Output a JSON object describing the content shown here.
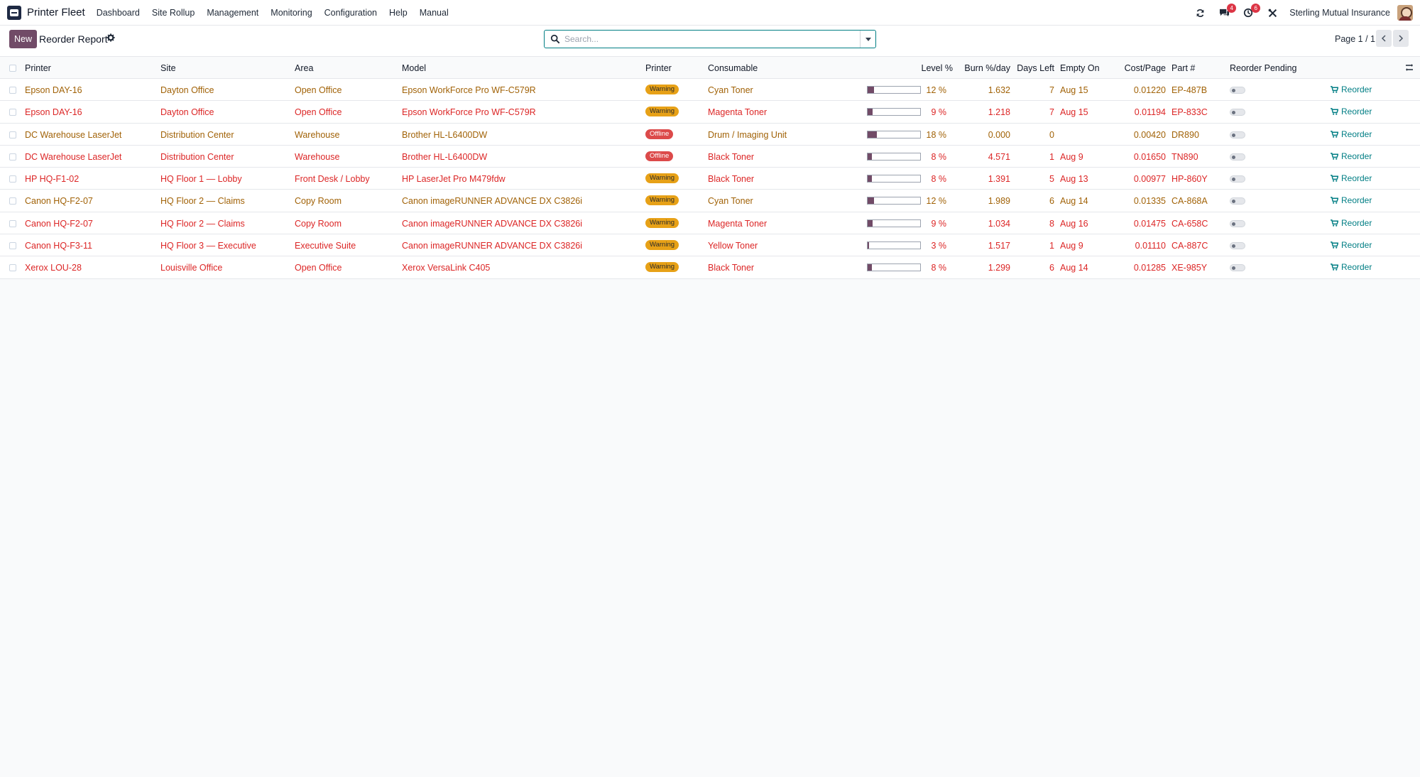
{
  "navbar": {
    "app_name": "Printer Fleet",
    "menu": [
      "Dashboard",
      "Site Rollup",
      "Management",
      "Monitoring",
      "Configuration",
      "Help",
      "Manual"
    ],
    "messages_count": "4",
    "activities_count": "6",
    "company": "Sterling Mutual Insurance"
  },
  "control": {
    "new_label": "New",
    "title": "Reorder Report",
    "search_placeholder": "Search...",
    "pager": "Page 1 / 1"
  },
  "table": {
    "headers": {
      "printer": "Printer",
      "site": "Site",
      "area": "Area",
      "model": "Model",
      "status": "Printer",
      "consumable": "Consumable",
      "level": "Level %",
      "burn": "Burn %/day",
      "days_left": "Days Left",
      "empty_on": "Empty On",
      "cost": "Cost/Page",
      "part": "Part #",
      "pending": "Reorder Pending"
    },
    "reorder_label": "Reorder",
    "rows": [
      {
        "tone": "warn",
        "printer": "Epson DAY-16",
        "site": "Dayton Office",
        "area": "Open Office",
        "model": "Epson WorkForce Pro WF-C579R",
        "status": "Warning",
        "consumable": "Cyan Toner",
        "level": 12,
        "level_text": "12 %",
        "burn": "1.632",
        "days_left": "7",
        "empty_on": "Aug 15",
        "cost": "0.01220",
        "part": "EP-487B"
      },
      {
        "tone": "danger",
        "printer": "Epson DAY-16",
        "site": "Dayton Office",
        "area": "Open Office",
        "model": "Epson WorkForce Pro WF-C579R",
        "status": "Warning",
        "consumable": "Magenta Toner",
        "level": 9,
        "level_text": "9 %",
        "burn": "1.218",
        "days_left": "7",
        "empty_on": "Aug 15",
        "cost": "0.01194",
        "part": "EP-833C"
      },
      {
        "tone": "warn",
        "printer": "DC Warehouse LaserJet",
        "site": "Distribution Center",
        "area": "Warehouse",
        "model": "Brother HL-L6400DW",
        "status": "Offline",
        "consumable": "Drum / Imaging Unit",
        "level": 18,
        "level_text": "18 %",
        "burn": "0.000",
        "days_left": "0",
        "empty_on": "",
        "cost": "0.00420",
        "part": "DR890"
      },
      {
        "tone": "danger",
        "printer": "DC Warehouse LaserJet",
        "site": "Distribution Center",
        "area": "Warehouse",
        "model": "Brother HL-L6400DW",
        "status": "Offline",
        "consumable": "Black Toner",
        "level": 8,
        "level_text": "8 %",
        "burn": "4.571",
        "days_left": "1",
        "empty_on": "Aug 9",
        "cost": "0.01650",
        "part": "TN890"
      },
      {
        "tone": "danger",
        "printer": "HP HQ-F1-02",
        "site": "HQ Floor 1 — Lobby",
        "area": "Front Desk / Lobby",
        "model": "HP LaserJet Pro M479fdw",
        "status": "Warning",
        "consumable": "Black Toner",
        "level": 8,
        "level_text": "8 %",
        "burn": "1.391",
        "days_left": "5",
        "empty_on": "Aug 13",
        "cost": "0.00977",
        "part": "HP-860Y"
      },
      {
        "tone": "warn",
        "printer": "Canon HQ-F2-07",
        "site": "HQ Floor 2 — Claims",
        "area": "Copy Room",
        "model": "Canon imageRUNNER ADVANCE DX C3826i",
        "status": "Warning",
        "consumable": "Cyan Toner",
        "level": 12,
        "level_text": "12 %",
        "burn": "1.989",
        "days_left": "6",
        "empty_on": "Aug 14",
        "cost": "0.01335",
        "part": "CA-868A"
      },
      {
        "tone": "danger",
        "printer": "Canon HQ-F2-07",
        "site": "HQ Floor 2 — Claims",
        "area": "Copy Room",
        "model": "Canon imageRUNNER ADVANCE DX C3826i",
        "status": "Warning",
        "consumable": "Magenta Toner",
        "level": 9,
        "level_text": "9 %",
        "burn": "1.034",
        "days_left": "8",
        "empty_on": "Aug 16",
        "cost": "0.01475",
        "part": "CA-658C"
      },
      {
        "tone": "danger",
        "printer": "Canon HQ-F3-11",
        "site": "HQ Floor 3 — Executive",
        "area": "Executive Suite",
        "model": "Canon imageRUNNER ADVANCE DX C3826i",
        "status": "Warning",
        "consumable": "Yellow Toner",
        "level": 3,
        "level_text": "3 %",
        "burn": "1.517",
        "days_left": "1",
        "empty_on": "Aug 9",
        "cost": "0.01110",
        "part": "CA-887C"
      },
      {
        "tone": "danger",
        "printer": "Xerox LOU-28",
        "site": "Louisville Office",
        "area": "Open Office",
        "model": "Xerox VersaLink C405",
        "status": "Warning",
        "consumable": "Black Toner",
        "level": 8,
        "level_text": "8 %",
        "burn": "1.299",
        "days_left": "6",
        "empty_on": "Aug 14",
        "cost": "0.01285",
        "part": "XE-985Y"
      }
    ]
  },
  "colors": {
    "primary": "#714b67",
    "teal": "#017e84",
    "warning_text": "#a16207",
    "danger_text": "#dc2626"
  }
}
